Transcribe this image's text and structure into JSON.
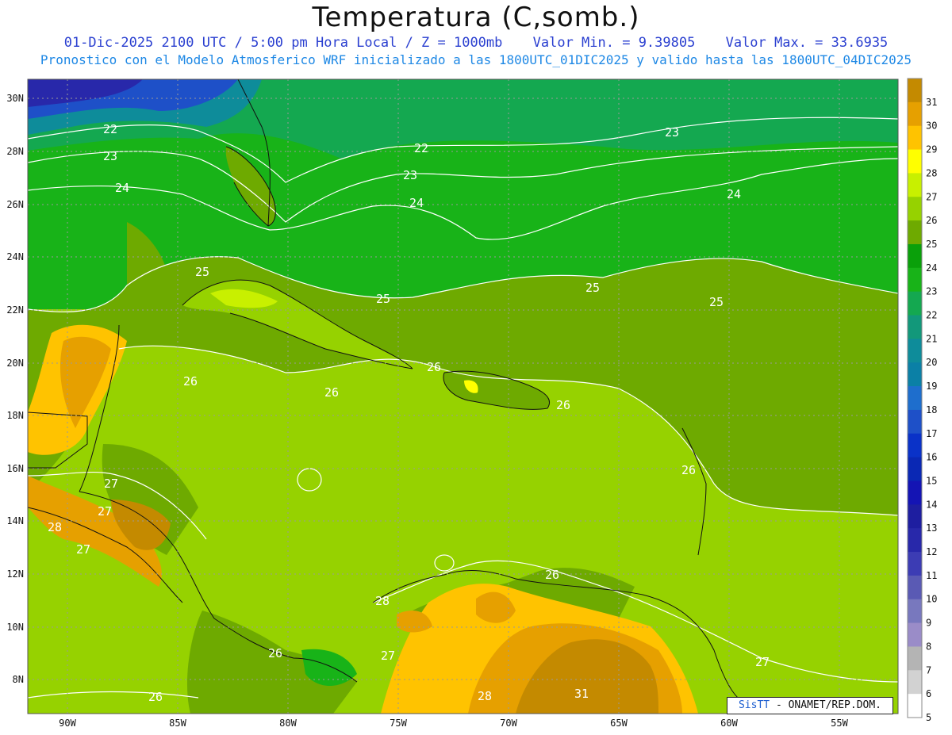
{
  "title": "Temperatura (C,somb.)",
  "subtitle": {
    "datetime": "01-Dic-2025  2100 UTC / 5:00 pm Hora Local / Z = 1000mb",
    "min": "Valor Min. = 9.39805",
    "max": "Valor Max. = 33.6935",
    "forecast": "Pronostico con el Modelo Atmosferico WRF inicializado a las 1800UTC_01DIC2025 y valido hasta las  1800UTC_04DIC2025"
  },
  "credit": {
    "logo": "SisTT",
    "text": "- ONAMET/REP.DOM."
  },
  "map": {
    "lat_ticks": [
      "30N",
      "28N",
      "26N",
      "24N",
      "22N",
      "20N",
      "18N",
      "16N",
      "14N",
      "12N",
      "10N",
      "8N"
    ],
    "lon_ticks": [
      "90W",
      "85W",
      "80W",
      "75W",
      "70W",
      "65W",
      "60W",
      "55W"
    ],
    "contour_labels": [
      "22",
      "23",
      "24",
      "22",
      "23",
      "24",
      "23",
      "24",
      "25",
      "25",
      "25",
      "25",
      "26",
      "26",
      "26",
      "26",
      "26",
      "27",
      "27",
      "27",
      "28",
      "28",
      "27",
      "26",
      "26",
      "27",
      "26",
      "28",
      "31"
    ],
    "colorbar": {
      "ticks": [
        "31",
        "30",
        "29",
        "28",
        "27",
        "26",
        "25",
        "24",
        "23",
        "22",
        "21",
        "20",
        "19",
        "18",
        "17",
        "16",
        "15",
        "14",
        "13",
        "12",
        "11",
        "10",
        "9",
        "8",
        "7",
        "6",
        "5"
      ],
      "colors": [
        "#c48a00",
        "#e6a000",
        "#ffc300",
        "#ffff00",
        "#c8f000",
        "#96d200",
        "#6eaa00",
        "#0aa00a",
        "#18b318",
        "#14a850",
        "#12987a",
        "#0e8c9a",
        "#0b80a6",
        "#1e6ecd",
        "#1e50c8",
        "#0a32c8",
        "#0a28b4",
        "#1414b4",
        "#1e1ea0",
        "#2828aa",
        "#3c3cb4",
        "#5a5ab4",
        "#7878be",
        "#9a8cc8",
        "#b4b4b4",
        "#d2d2d2",
        "#ffffff"
      ]
    }
  }
}
